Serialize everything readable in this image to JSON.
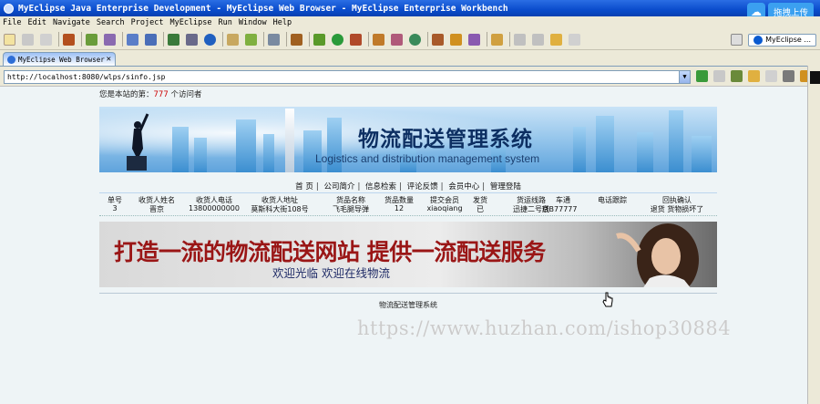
{
  "window": {
    "title": "MyEclipse Java Enterprise Development - MyEclipse Web Browser - MyEclipse Enterprise Workbench",
    "cloud_button": "拖拽上传"
  },
  "menu": [
    "File",
    "Edit",
    "Navigate",
    "Search",
    "Project",
    "MyEclipse",
    "Run",
    "Window",
    "Help"
  ],
  "perspective": {
    "label": "MyEclipse ..."
  },
  "tab": {
    "label": "MyEclipse Web Browser",
    "close": "✕"
  },
  "address": {
    "url": "http://localhost:8080/wlps/sinfo.jsp",
    "dropdown": "▼"
  },
  "page": {
    "visitor_prefix": "您是本站的第：",
    "visitor_count": "777",
    "visitor_suffix": " 个访问者",
    "banner_title": "物流配送管理系统",
    "banner_subtitle": "Logistics and distribution management system",
    "nav": [
      "首 页",
      "公司简介",
      "信息检索",
      "评论反馈",
      "会员中心",
      "管理登陆"
    ],
    "table": {
      "headers": [
        "单号",
        "收货人姓名",
        "收货人电话",
        "收货人地址",
        "货品名称",
        "货品数量",
        "提交会员",
        "发货",
        "货运线路",
        "车通",
        "电话跟踪",
        "回执确认"
      ],
      "row": [
        "3",
        "晋京",
        "13800000000",
        "莫斯科大街108号",
        "飞毛腿导弹",
        "12",
        "xiaoqiang",
        "已",
        "迅捷二号线",
        "京B77777",
        "",
        "退货  货物损坏了"
      ]
    },
    "ad_slogan": "打造一流的物流配送网站 提供一流配送服务",
    "ad_welcome": "欢迎光临 欢迎在线物流",
    "footer": "物流配送管理系统"
  },
  "watermark": "https://www.huzhan.com/ishop30884",
  "colors": {
    "titlebar": "#0a4ccc",
    "visitor_count": "#cc0000",
    "slogan": "#9a1616"
  }
}
